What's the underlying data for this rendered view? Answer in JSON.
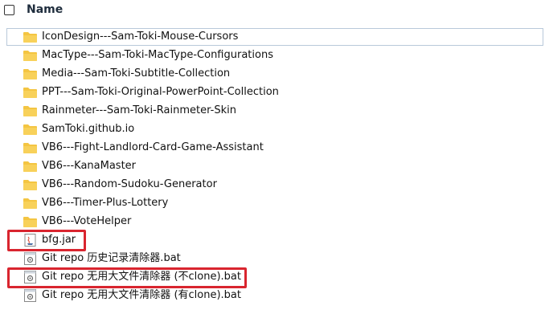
{
  "header": {
    "name_label": "Name"
  },
  "files": [
    {
      "name": "IconDesign---Sam-Toki-Mouse-Cursors",
      "type": "folder",
      "icon": "folder-icon"
    },
    {
      "name": "MacType---Sam-Toki-MacType-Configurations",
      "type": "folder",
      "icon": "folder-icon"
    },
    {
      "name": "Media---Sam-Toki-Subtitle-Collection",
      "type": "folder",
      "icon": "folder-icon"
    },
    {
      "name": "PPT---Sam-Toki-Original-PowerPoint-Collection",
      "type": "folder",
      "icon": "folder-icon"
    },
    {
      "name": "Rainmeter---Sam-Toki-Rainmeter-Skin",
      "type": "folder",
      "icon": "folder-icon"
    },
    {
      "name": "SamToki.github.io",
      "type": "folder",
      "icon": "folder-icon"
    },
    {
      "name": "VB6---Fight-Landlord-Card-Game-Assistant",
      "type": "folder",
      "icon": "folder-icon"
    },
    {
      "name": "VB6---KanaMaster",
      "type": "folder",
      "icon": "folder-icon"
    },
    {
      "name": "VB6---Random-Sudoku-Generator",
      "type": "folder",
      "icon": "folder-icon"
    },
    {
      "name": "VB6---Timer-Plus-Lottery",
      "type": "folder",
      "icon": "folder-icon"
    },
    {
      "name": "VB6---VoteHelper",
      "type": "folder",
      "icon": "folder-icon"
    },
    {
      "name": "bfg.jar",
      "type": "jar",
      "icon": "java-jar-icon",
      "highlighted": true
    },
    {
      "name": "Git repo 历史记录清除器.bat",
      "type": "bat",
      "icon": "batch-file-icon"
    },
    {
      "name": "Git repo 无用大文件清除器 (不clone).bat",
      "type": "bat",
      "icon": "batch-file-icon",
      "highlighted": true
    },
    {
      "name": "Git repo 无用大文件清除器 (有clone).bat",
      "type": "bat",
      "icon": "batch-file-icon"
    }
  ],
  "colors": {
    "folder": "#f4c542",
    "highlight": "#d9252f",
    "selection_border": "#b9c9da"
  }
}
